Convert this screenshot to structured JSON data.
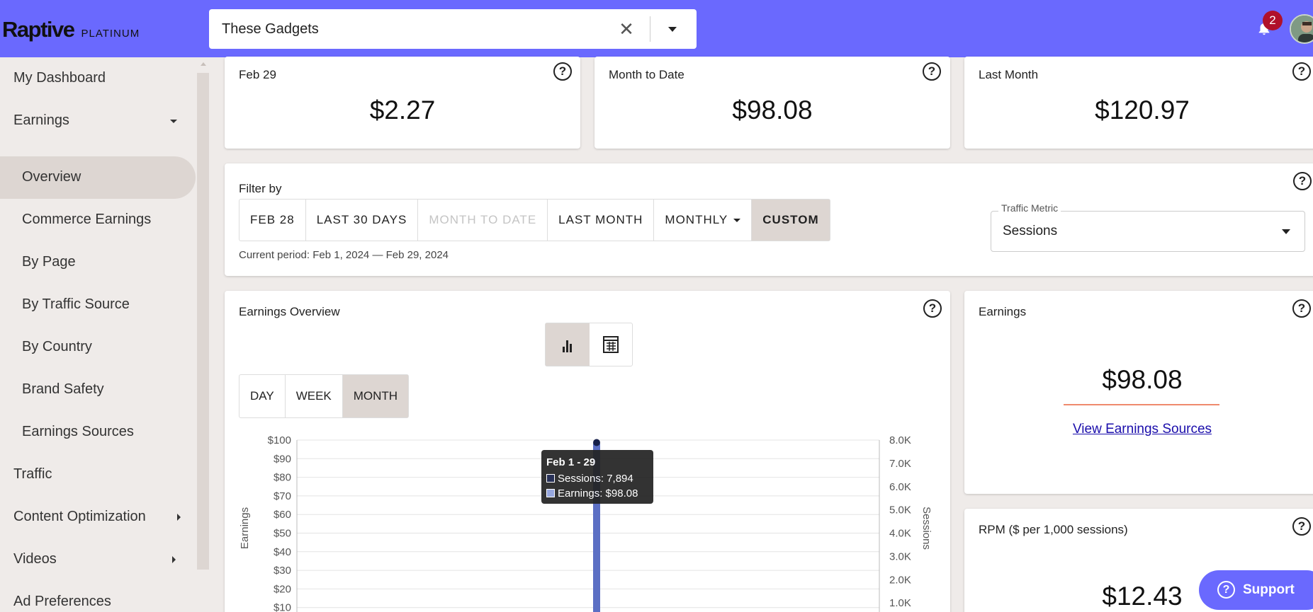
{
  "header": {
    "brand": "Raptive",
    "tier": "PLATINUM",
    "site_selector": {
      "value": "These Gadgets"
    },
    "notifications_count": "2"
  },
  "sidebar": {
    "items": [
      {
        "label": "My Dashboard"
      },
      {
        "label": "Earnings"
      },
      {
        "label": "Overview"
      },
      {
        "label": "Commerce Earnings"
      },
      {
        "label": "By Page"
      },
      {
        "label": "By Traffic Source"
      },
      {
        "label": "By Country"
      },
      {
        "label": "Brand Safety"
      },
      {
        "label": "Earnings Sources"
      },
      {
        "label": "Traffic"
      },
      {
        "label": "Content Optimization"
      },
      {
        "label": "Videos"
      },
      {
        "label": "Ad Preferences"
      }
    ]
  },
  "stats": [
    {
      "label": "Feb 29",
      "value": "$2.27"
    },
    {
      "label": "Month to Date",
      "value": "$98.08"
    },
    {
      "label": "Last Month",
      "value": "$120.97"
    }
  ],
  "filter": {
    "title": "Filter by",
    "buttons": [
      "FEB 28",
      "LAST 30 DAYS",
      "MONTH TO DATE",
      "LAST MONTH",
      "MONTHLY",
      "CUSTOM"
    ],
    "current_period": "Current period: Feb 1, 2024 — Feb 29, 2024",
    "traffic_metric_label": "Traffic Metric",
    "traffic_metric_value": "Sessions"
  },
  "earnings_overview": {
    "title": "Earnings Overview",
    "view_toggle": [
      "chart-view",
      "table-view"
    ],
    "periods": [
      "DAY",
      "WEEK",
      "MONTH"
    ],
    "tooltip": {
      "title": "Feb 1 - 29",
      "sessions": "Sessions: 7,894",
      "earnings": "Earnings: $98.08"
    }
  },
  "earnings_card": {
    "title": "Earnings",
    "value": "$98.08",
    "link": "View Earnings Sources"
  },
  "rpm_card": {
    "title": "RPM ($ per 1,000 sessions)",
    "value": "$12.43"
  },
  "support_label": "Support",
  "colors": {
    "brand": "#6a69fe",
    "earnings_bar": "#5b6fc4",
    "sessions_line": "#16204a",
    "accent": "#ef8a6d",
    "badge": "#b0102a"
  },
  "chart_data": {
    "type": "bar",
    "categories": [
      "Feb 1 - 29"
    ],
    "series": [
      {
        "name": "Earnings",
        "values": [
          98.08
        ],
        "axis": "left"
      },
      {
        "name": "Sessions",
        "values": [
          7894
        ],
        "axis": "right"
      }
    ],
    "ylabel": "Earnings",
    "y2label": "Sessions",
    "ylim": [
      0,
      100
    ],
    "y2lim": [
      0,
      8000
    ],
    "y_ticks": [
      "$100",
      "$90",
      "$80",
      "$70",
      "$60",
      "$50",
      "$40",
      "$30",
      "$20",
      "$10"
    ],
    "y2_ticks": [
      "8.0K",
      "7.0K",
      "6.0K",
      "5.0K",
      "4.0K",
      "3.0K",
      "2.0K",
      "1.0K"
    ],
    "grid": true
  }
}
